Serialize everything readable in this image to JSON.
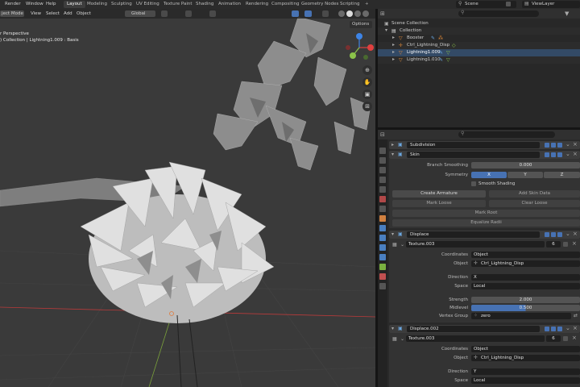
{
  "menubar": {
    "items": [
      "Render",
      "Window",
      "Help"
    ],
    "workspaces": [
      "Layout",
      "Modeling",
      "Sculpting",
      "UV Editing",
      "Texture Paint",
      "Shading",
      "Animation",
      "Rendering",
      "Compositing",
      "Geometry Nodes",
      "Scripting"
    ],
    "add_tab": "+",
    "active_workspace": "Layout",
    "scene": "Scene",
    "viewlayer": "ViewLayer"
  },
  "viewport": {
    "mode": "ject Mode",
    "menus": [
      "View",
      "Select",
      "Add",
      "Object"
    ],
    "transform": "Global",
    "overlay_title": "r Perspective",
    "overlay_sub": ") Collection | Lightning1.009 : Basis",
    "options": "Options"
  },
  "outliner": {
    "root": "Scene Collection",
    "collection": "Collection",
    "items": [
      "Booster",
      "Ctrl_Lightning_Disp",
      "Lightning1.009",
      "Lightning1.010"
    ]
  },
  "properties": {
    "subdivision": "Subdivision",
    "skin": {
      "name": "Skin",
      "branch_label": "Branch Smoothing",
      "branch_value": "0.000",
      "symmetry_label": "Symmetry",
      "sym_x": "X",
      "sym_y": "Y",
      "sym_z": "Z",
      "smooth_shading": "Smooth Shading",
      "create_armature": "Create Armature",
      "add_skin_data": "Add Skin Data",
      "mark_loose": "Mark Loose",
      "clear_loose": "Clear Loose",
      "mark_root": "Mark Root",
      "equalize_radii": "Equalize Radii"
    },
    "displace1": {
      "name": "Displace",
      "texture": "Texture.003",
      "tex_users": "6",
      "coordinates_label": "Coordinates",
      "coordinates_value": "Object",
      "object_label": "Object",
      "object_value": "Ctrl_Lightning_Disp",
      "direction_label": "Direction",
      "direction_value": "X",
      "space_label": "Space",
      "space_value": "Local",
      "strength_label": "Strength",
      "strength_value": "2.000",
      "midlevel_label": "Midlevel",
      "midlevel_value": "0.500",
      "vgroup_label": "Vertex Group",
      "vgroup_value": "zero"
    },
    "displace2": {
      "name": "Displace.002",
      "texture": "Texture.003",
      "tex_users": "6",
      "coordinates_label": "Coordinates",
      "coordinates_value": "Object",
      "object_label": "Object",
      "object_value": "Ctrl_Lightning_Disp",
      "direction_label": "Direction",
      "direction_value": "Y",
      "space_label": "Space",
      "space_value": "Local"
    }
  },
  "colors": {
    "accent": "#4772b3",
    "axis_x": "#e0403f",
    "axis_y": "#8bc34a",
    "axis_z": "#3d84e6"
  }
}
